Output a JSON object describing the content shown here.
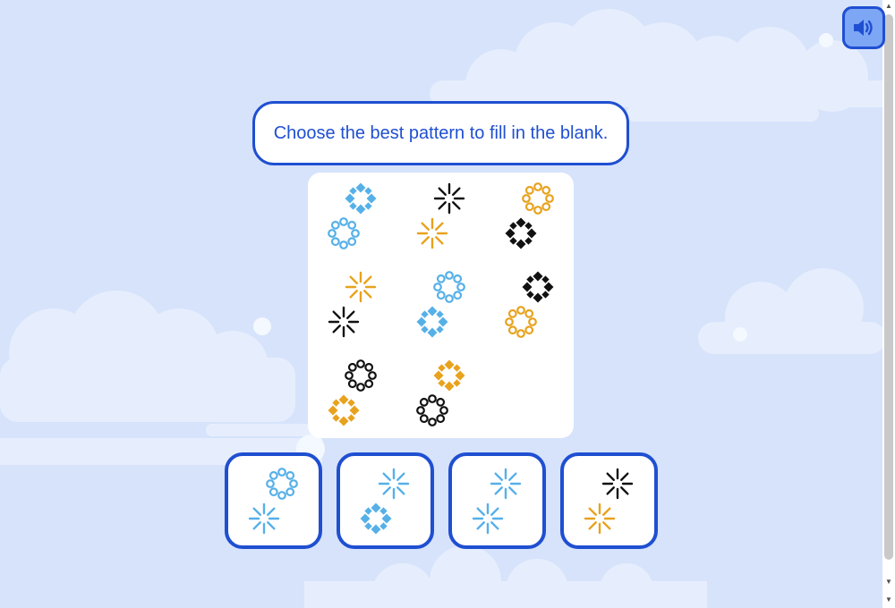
{
  "prompt": {
    "text": "Choose the best pattern to fill in the blank."
  },
  "colors": {
    "blue": "#56b0e8",
    "black": "#111111",
    "orange": "#e8a21d",
    "accent": "#1f4fd1"
  },
  "sound_button": {
    "icon": "speaker-icon"
  },
  "scrollbar": {
    "up": "▲",
    "down": "▼"
  },
  "grid": [
    {
      "row": 1,
      "col": 1,
      "top": {
        "shape": "diamond-burst",
        "color": "blue"
      },
      "bottom": {
        "shape": "ring",
        "color": "blue"
      }
    },
    {
      "row": 1,
      "col": 2,
      "top": {
        "shape": "dash-burst",
        "color": "black"
      },
      "bottom": {
        "shape": "dash-burst",
        "color": "orange"
      }
    },
    {
      "row": 1,
      "col": 3,
      "top": {
        "shape": "ring",
        "color": "orange"
      },
      "bottom": {
        "shape": "diamond-burst",
        "color": "black"
      }
    },
    {
      "row": 2,
      "col": 1,
      "top": {
        "shape": "dash-burst",
        "color": "orange"
      },
      "bottom": {
        "shape": "dash-burst",
        "color": "black"
      }
    },
    {
      "row": 2,
      "col": 2,
      "top": {
        "shape": "ring",
        "color": "blue"
      },
      "bottom": {
        "shape": "diamond-burst",
        "color": "blue"
      }
    },
    {
      "row": 2,
      "col": 3,
      "top": {
        "shape": "diamond-burst",
        "color": "black"
      },
      "bottom": {
        "shape": "ring",
        "color": "orange"
      }
    },
    {
      "row": 3,
      "col": 1,
      "top": {
        "shape": "ring",
        "color": "black"
      },
      "bottom": {
        "shape": "diamond-burst",
        "color": "orange"
      }
    },
    {
      "row": 3,
      "col": 2,
      "top": {
        "shape": "diamond-burst",
        "color": "orange"
      },
      "bottom": {
        "shape": "ring",
        "color": "black"
      }
    },
    {
      "row": 3,
      "col": 3,
      "blank": true
    }
  ],
  "choices": [
    {
      "top": {
        "shape": "ring",
        "color": "blue"
      },
      "bottom": {
        "shape": "dash-burst",
        "color": "blue"
      }
    },
    {
      "top": {
        "shape": "dash-burst",
        "color": "blue"
      },
      "bottom": {
        "shape": "diamond-burst",
        "color": "blue"
      }
    },
    {
      "top": {
        "shape": "dash-burst",
        "color": "blue"
      },
      "bottom": {
        "shape": "dash-burst",
        "color": "blue"
      }
    },
    {
      "top": {
        "shape": "dash-burst",
        "color": "black"
      },
      "bottom": {
        "shape": "dash-burst",
        "color": "orange"
      }
    }
  ]
}
